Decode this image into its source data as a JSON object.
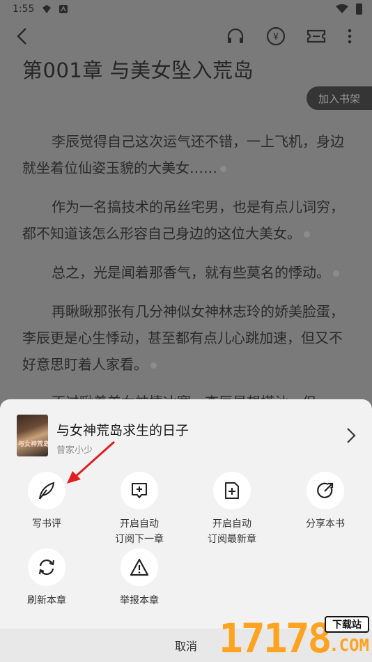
{
  "status_bar": {
    "time": "1:55"
  },
  "reader": {
    "chapter_title": "第001章 与美女坠入荒岛",
    "add_shelf_label": "加入书架",
    "paragraphs": [
      "李辰觉得自己这次运气还不错，一上飞机，身边就坐着位仙姿玉貌的大美女……",
      "作为一名搞技术的吊丝宅男，也是有点儿词穷，都不知道该怎么形容自己身边的这位大美女。",
      "总之，光是闻着那香气，就有些莫名的悸动。",
      "再瞅瞅那张有几分神似女神林志玲的娇美脸蛋，李辰更是心生悸动，甚至都有点儿心跳加速，但又不好意思盯着人家看。",
      "不过瞅着美女神情冰寒，李辰是想搭讪，但"
    ]
  },
  "sheet": {
    "book_title": "与女神荒岛求生的日子",
    "book_author": "曾家小少",
    "cover_text": "与女神荒岛",
    "actions": [
      {
        "label": "写书评",
        "icon": "feather-pen-icon"
      },
      {
        "label": "开启自动\n订阅下一章",
        "icon": "add-square-icon"
      },
      {
        "label": "开启自动\n订阅最新章",
        "icon": "add-document-icon"
      },
      {
        "label": "分享本书",
        "icon": "share-arrow-icon"
      },
      {
        "label": "刷新本章",
        "icon": "refresh-icon"
      },
      {
        "label": "举报本章",
        "icon": "warning-triangle-icon"
      }
    ],
    "cancel_label": "取消"
  },
  "watermark": {
    "number": "17178",
    "tag": "下载站",
    "suffix": ".COM"
  },
  "colors": {
    "accent": "#ffa320",
    "arrow": "#e02020",
    "sheet_bg": "#f2f2f2"
  }
}
